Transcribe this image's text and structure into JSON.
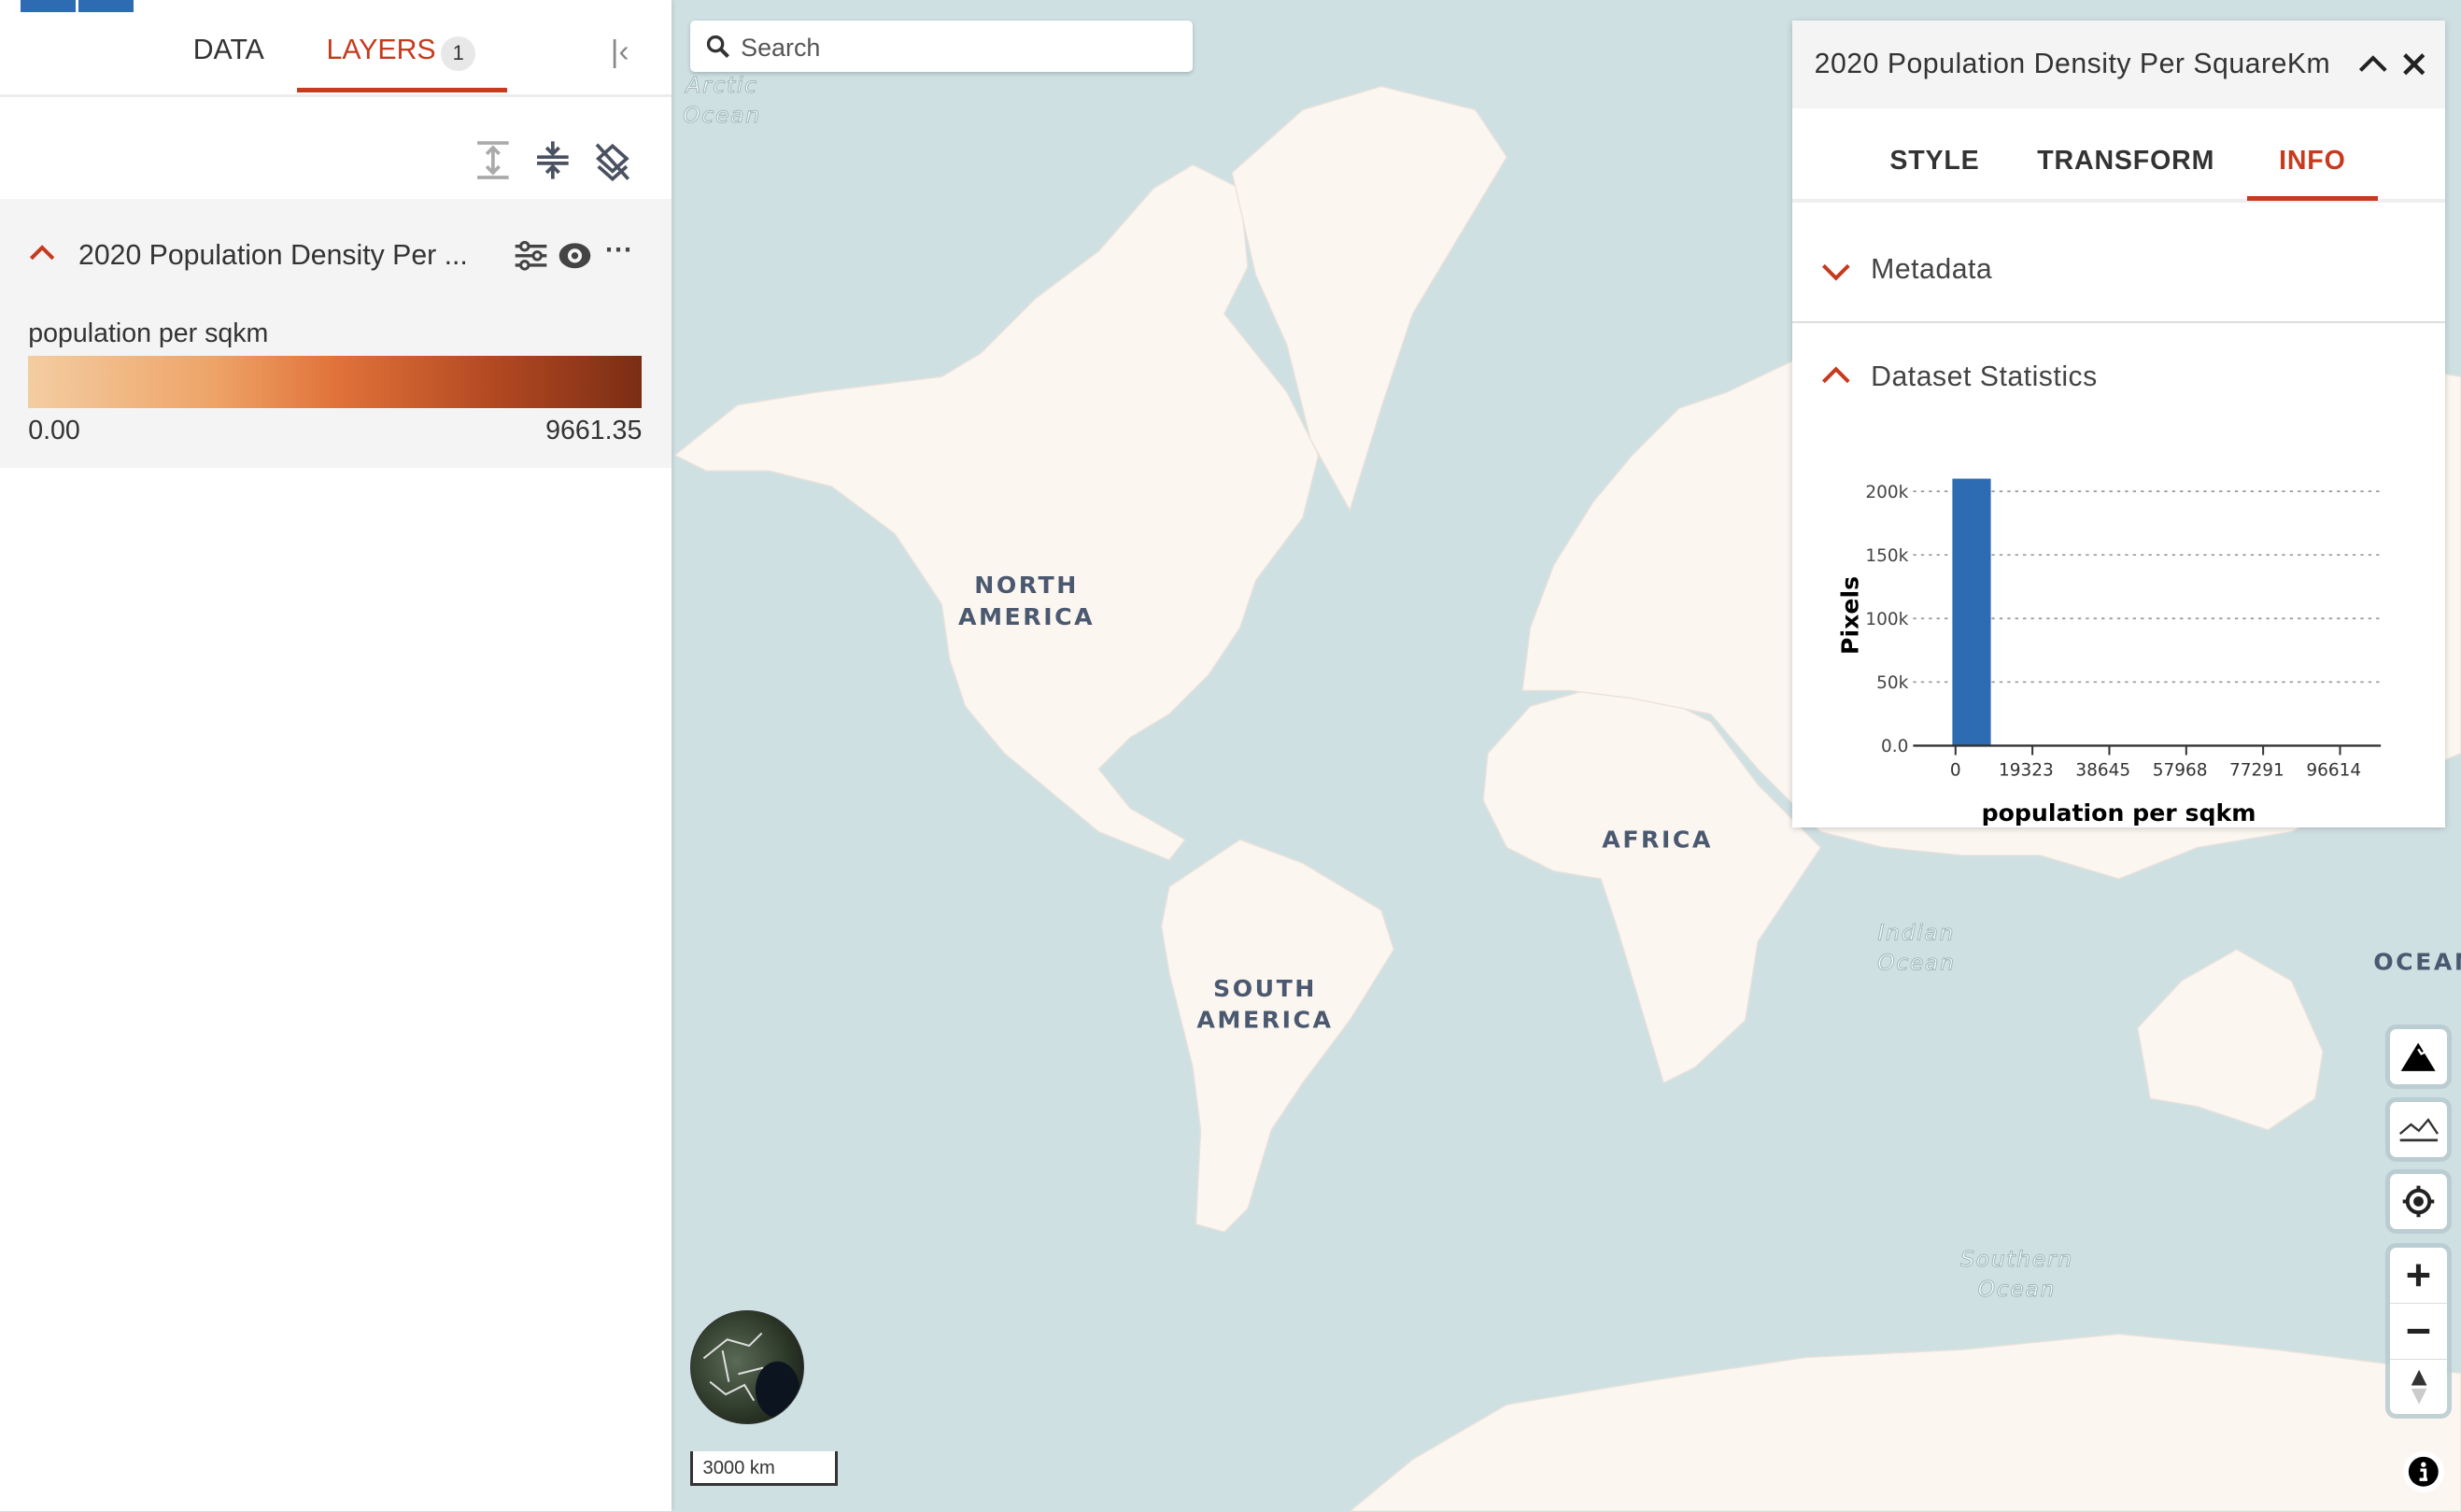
{
  "left_panel": {
    "tabs": [
      {
        "label": "DATA"
      },
      {
        "label": "LAYERS",
        "badge": "1",
        "active": true
      }
    ],
    "tools": [
      "expand-all-icon",
      "collapse-all-icon",
      "remove-all-layers-icon"
    ],
    "layer": {
      "title": "2020 Population Density Per ...",
      "legend_label": "population per sqkm",
      "ramp_min": "0.00",
      "ramp_max": "9661.35",
      "ramp_colors": [
        "#f4cda2",
        "#eea468",
        "#e1733a",
        "#b44a22",
        "#7b2d14"
      ]
    }
  },
  "search": {
    "placeholder": "Search",
    "value": ""
  },
  "map": {
    "labels": {
      "arctic": [
        "Arctic",
        "Ocean"
      ],
      "north_america": [
        "NORTH",
        "AMERICA"
      ],
      "south_america": [
        "SOUTH",
        "AMERICA"
      ],
      "africa": "AFRICA",
      "indian": [
        "Indian",
        "Ocean"
      ],
      "ocean_right": "OCEAN",
      "southern": [
        "Southern",
        "Ocean"
      ]
    },
    "scale": "3000 km",
    "colors": {
      "water": "#cfe0e3",
      "land": "#fbf6f0"
    }
  },
  "info_panel": {
    "title": "2020 Population Density Per SquareKm",
    "tabs": [
      {
        "label": "STYLE"
      },
      {
        "label": "TRANSFORM"
      },
      {
        "label": "INFO",
        "active": true
      }
    ],
    "sections": [
      {
        "label": "Metadata",
        "expanded": false
      },
      {
        "label": "Dataset Statistics",
        "expanded": true
      }
    ]
  },
  "accent_color": "#c63a1e",
  "chart_data": {
    "type": "bar",
    "xlabel": "population per sqkm",
    "ylabel": "Pixels",
    "bin_edges": [
      0,
      9661.35
    ],
    "x": [
      0
    ],
    "values": [
      210000
    ],
    "x_ticks": [
      "0",
      "19323",
      "38645",
      "57968",
      "77291",
      "96614"
    ],
    "x_tick_values": [
      0,
      19323,
      38645,
      57968,
      77291,
      96614
    ],
    "y_ticks": [
      "0.0",
      "50k",
      "100k",
      "150k",
      "200k"
    ],
    "y_tick_values": [
      0,
      50000,
      100000,
      150000,
      200000
    ],
    "ylim": [
      0,
      210000
    ],
    "grid": true,
    "color": "#2d6bb2"
  }
}
